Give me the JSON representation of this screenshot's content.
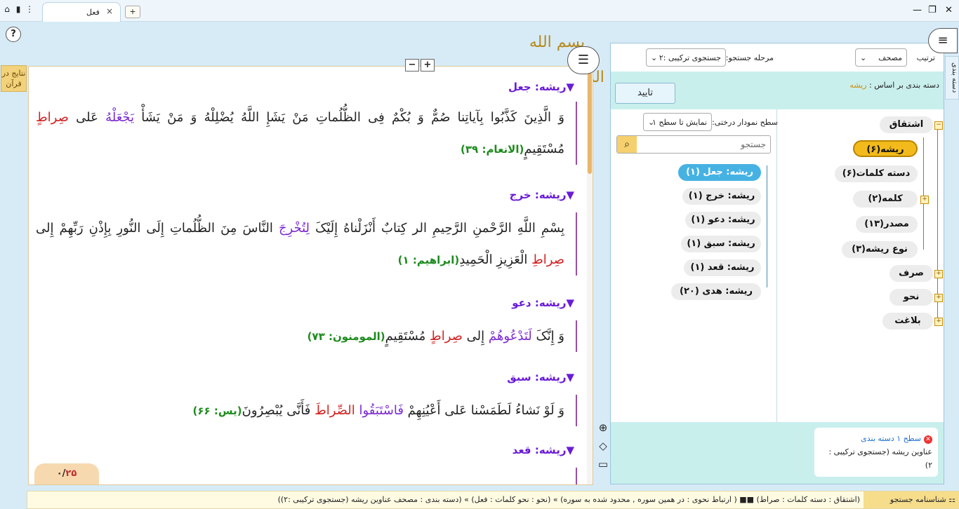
{
  "topbar": {
    "tab_label": "فعل",
    "tab_close": "×",
    "add_tab": "+",
    "icons": [
      "home-icon",
      "book-icon",
      "more-icon"
    ],
    "minimize": "—",
    "restore": "❐",
    "close": "✕"
  },
  "help": "?",
  "side_tab": "نتایج در قرآن",
  "header_calligraphy": "بسم الله الرحمن الرحیم",
  "zoom": {
    "minus": "−",
    "plus": "+"
  },
  "results": [
    {
      "root": "▼ریشه: جعل",
      "verse_parts": [
        {
          "t": "وَ الَّذِینَ کَذَّبُوا بِآیاتِنا صُمٌّ وَ بُکْمٌ فِی الظُّلُماتِ مَنْ یَشَإِ اللَّهُ یُضْلِلْهُ وَ مَنْ یَشَأْ ",
          "c": ""
        },
        {
          "t": "یَجْعَلْهُ",
          "c": "purple"
        },
        {
          "t": " عَلى ",
          "c": ""
        },
        {
          "t": "صِراطٍ",
          "c": "red"
        },
        {
          "t": " مُسْتَقِیمٍ",
          "c": ""
        }
      ],
      "ref": "(الانعام: ٣٩)"
    },
    {
      "root": "▼ریشه: خرج",
      "verse_parts": [
        {
          "t": "بِسْمِ اللَّهِ الرَّحْمنِ الرَّحِیمِ الر کِتابٌ أَنْزَلْناهُ إِلَیْکَ ",
          "c": ""
        },
        {
          "t": "لِتُخْرِجَ",
          "c": "purple"
        },
        {
          "t": " النَّاسَ مِنَ الظُّلُماتِ إِلَى النُّورِ بِإِذْنِ رَبِّهِمْ إِلى ",
          "c": ""
        },
        {
          "t": "صِراطِ",
          "c": "red"
        },
        {
          "t": " الْعَزِیزِ الْحَمِیدِ",
          "c": ""
        }
      ],
      "ref": "(ابراهیم: ١)"
    },
    {
      "root": "▼ریشه: دعو",
      "verse_parts": [
        {
          "t": "وَ إِنَّکَ ",
          "c": ""
        },
        {
          "t": "لَتَدْعُوهُمْ",
          "c": "purple"
        },
        {
          "t": " إِلى ",
          "c": ""
        },
        {
          "t": "صِراطٍ",
          "c": "red"
        },
        {
          "t": " مُسْتَقِیمٍ",
          "c": ""
        }
      ],
      "ref": "(المومنون: ٧٣)"
    },
    {
      "root": "▼ریشه: سبق",
      "verse_parts": [
        {
          "t": "وَ لَوْ نَشاءُ لَطَمَسْنا عَلى أَعْیُنِهِمْ ",
          "c": ""
        },
        {
          "t": "فَاسْتَبَقُوا",
          "c": "purple"
        },
        {
          "t": " ",
          "c": ""
        },
        {
          "t": "الصِّراطَ",
          "c": "red"
        },
        {
          "t": " فَأَنَّى یُبْصِرُونَ",
          "c": ""
        }
      ],
      "ref": "(یس: ۶۶)"
    },
    {
      "root": "▼ریشه: قعد",
      "verse_parts": [],
      "ref": ""
    }
  ],
  "pager": {
    "current": "٢۵",
    "sep": "/",
    "total": "٠"
  },
  "search_panel": {
    "sort_label": "ترتیب",
    "sort_value": "مصحف",
    "stage_label": "مرحله جستجو:",
    "stage_value": "جستجوی ترکیبی :٢",
    "category_label": "دسته بندی بر اساس :",
    "category_value": "ریشه",
    "confirm": "تایید",
    "tree_level_label": "سطح نمودار درختی:",
    "tree_level_value": "نمایش تا سطح ١",
    "search_placeholder": "جستجو",
    "category_tree": [
      {
        "label": "اشتقاق",
        "sel": false
      },
      {
        "label": "ریشه(۶)",
        "sel": true
      },
      {
        "label": "دسته کلمات(۶)",
        "sel": false
      },
      {
        "label": "کلمه(٢)",
        "sel": false
      },
      {
        "label": "مصدر(١٣)",
        "sel": false
      },
      {
        "label": "نوع ریشه(٣)",
        "sel": false
      },
      {
        "label": "صرف",
        "sel": false
      },
      {
        "label": "نحو",
        "sel": false
      },
      {
        "label": "بلاغت",
        "sel": false
      }
    ],
    "root_list": [
      {
        "label": "ریشه: جعل (١)",
        "sel": true
      },
      {
        "label": "ریشه: خرج (١)",
        "sel": false
      },
      {
        "label": "ریشه: دعو (١)",
        "sel": false
      },
      {
        "label": "ریشه: سبق (١)",
        "sel": false
      },
      {
        "label": "ریشه: قعد (١)",
        "sel": false
      },
      {
        "label": "ریشه: هدی (٢٠)",
        "sel": false
      }
    ],
    "level_card": {
      "title": "سطح ١ دسته بندی",
      "body": "عناوین ریشه (جستجوی ترکیبی : ٢)"
    }
  },
  "vertical_tab": "دسته بندی",
  "statusbar": {
    "title": "شناسنامه جستجو",
    "text": "(اشتقاق : دسته کلمات : صراط) ■■ ( ارتباط نحوی : در همین سوره , محدود شده به سوره) » (نحو : نحو کلمات : فعل) » (دسته بندی : مصحف عناوین ریشه (جستجوی ترکیبی :٢))"
  }
}
